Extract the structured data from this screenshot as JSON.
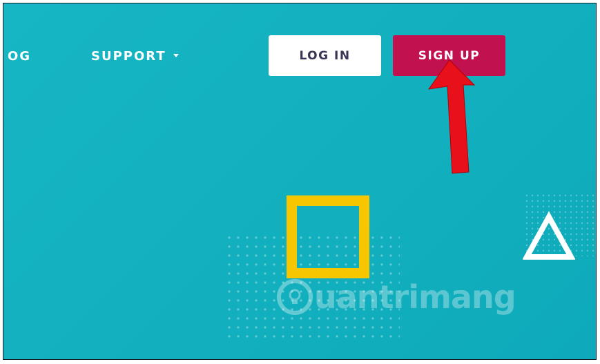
{
  "nav": {
    "blog_label": "OG",
    "support_label": "SUPPORT"
  },
  "auth": {
    "login_label": "LOG IN",
    "signup_label": "SIGN UP"
  },
  "watermark": {
    "text": "uantrimang"
  },
  "colors": {
    "background": "#13b1bf",
    "signup_button": "#c2114f",
    "login_button": "#ffffff",
    "arrow": "#e8101a",
    "square": "#f6c600",
    "triangle": "#ffffff"
  },
  "icons": [
    "chevron-down-icon",
    "red-arrow-annotation",
    "lightbulb-icon"
  ]
}
